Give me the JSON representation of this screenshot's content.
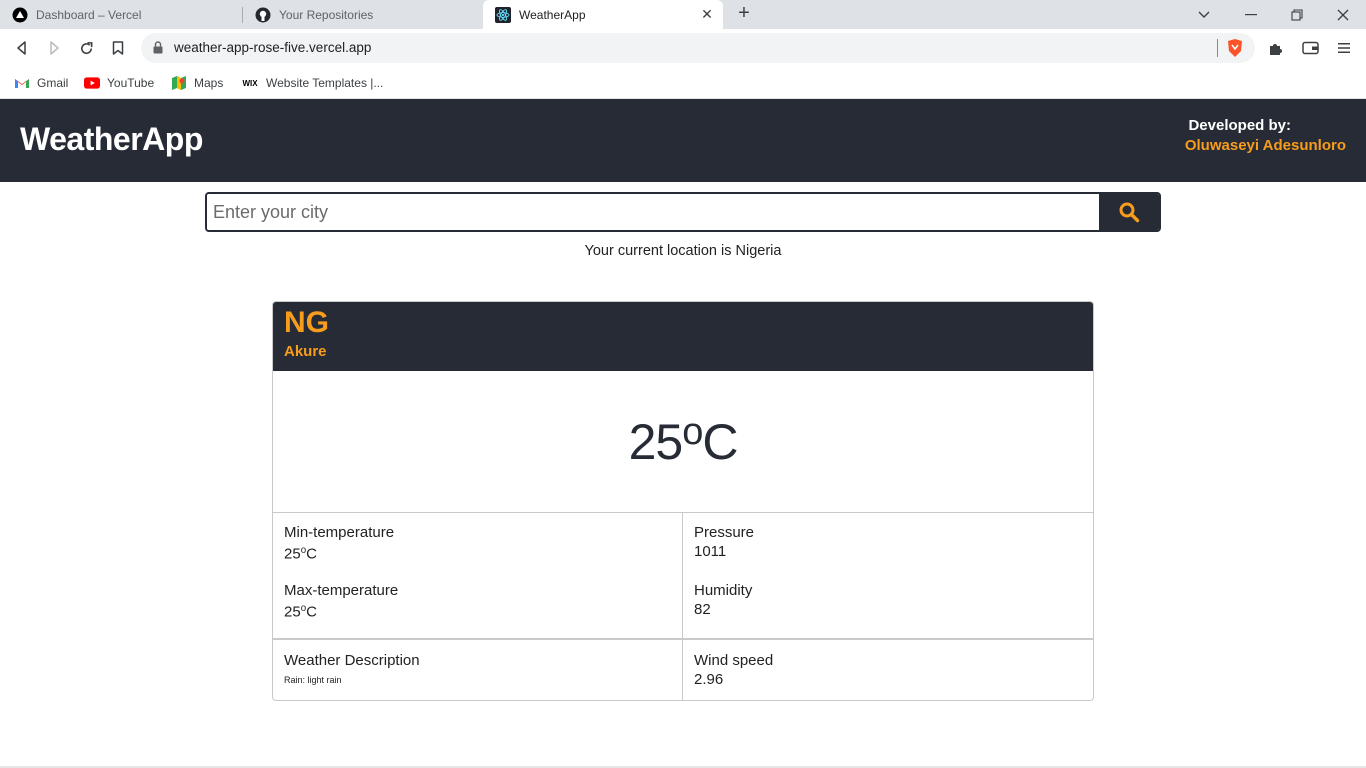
{
  "browser": {
    "tabs": [
      {
        "title": "Dashboard – Vercel",
        "icon": "vercel-icon"
      },
      {
        "title": "Your Repositories",
        "icon": "github-icon"
      },
      {
        "title": "WeatherApp",
        "icon": "react-icon",
        "active": true
      }
    ],
    "url": "weather-app-rose-five.vercel.app",
    "bookmarks": [
      {
        "label": "Gmail",
        "icon": "gmail-icon"
      },
      {
        "label": "YouTube",
        "icon": "youtube-icon"
      },
      {
        "label": "Maps",
        "icon": "maps-icon"
      },
      {
        "label": "Website Templates |...",
        "icon": "wix-icon",
        "icon_text": "WIX"
      }
    ]
  },
  "header": {
    "title": "WeatherApp",
    "developed_by_label": "Developed by:",
    "developer_name": "Oluwaseyi Adesunloro"
  },
  "search": {
    "placeholder": "Enter your city",
    "value": ""
  },
  "location_text": "Your current location is Nigeria",
  "weather": {
    "country": "NG",
    "city": "Akure",
    "temperature": "25",
    "unit": "C",
    "min_temp_label": "Min-temperature",
    "min_temp": "25",
    "max_temp_label": "Max-temperature",
    "max_temp": "25",
    "pressure_label": "Pressure",
    "pressure": "1011",
    "humidity_label": "Humidity",
    "humidity": "82",
    "description_label": "Weather Description",
    "description": "Rain: light rain",
    "wind_label": "Wind speed",
    "wind": "2.96"
  },
  "colors": {
    "dark": "#262b35",
    "accent": "#f79c1d"
  }
}
